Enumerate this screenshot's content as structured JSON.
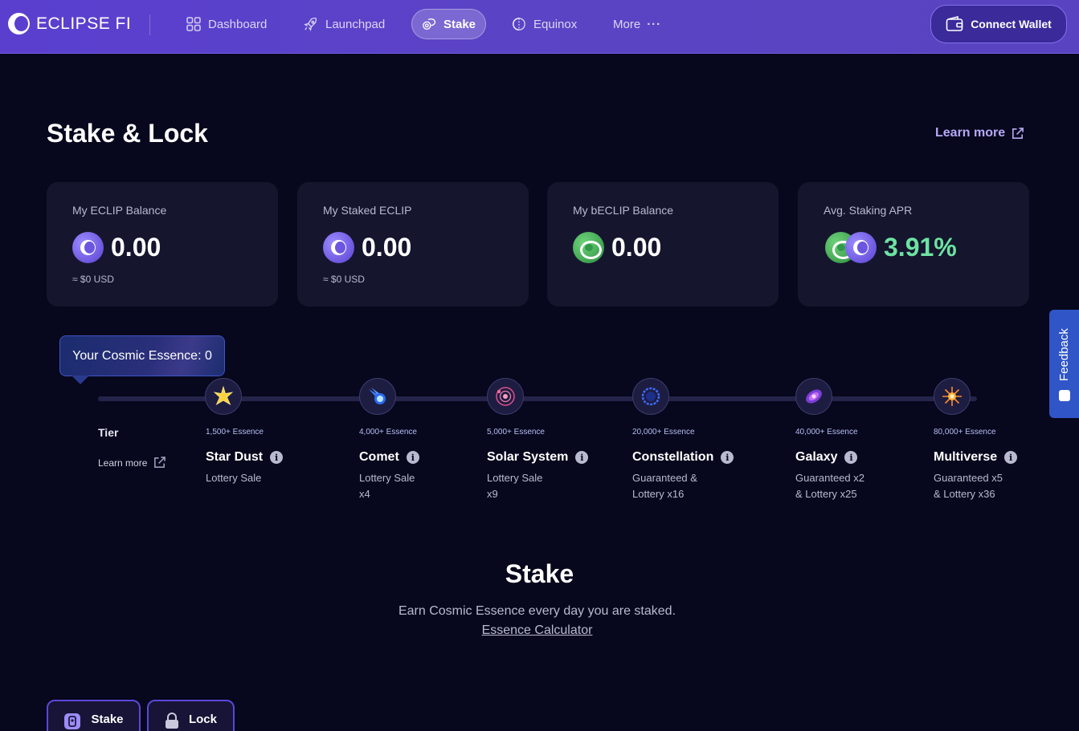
{
  "nav": {
    "brand": "ECLIPSE FI",
    "items": [
      {
        "label": "Dashboard",
        "icon": "grid-icon"
      },
      {
        "label": "Launchpad",
        "icon": "rocket-icon"
      },
      {
        "label": "Stake",
        "icon": "coins-icon",
        "active": true
      },
      {
        "label": "Equinox",
        "icon": "equinox-icon"
      },
      {
        "label": "More",
        "icon": "dots-icon"
      }
    ],
    "connect_label": "Connect Wallet"
  },
  "page": {
    "title": "Stake & Lock",
    "learn_more": "Learn more"
  },
  "cards": [
    {
      "label": "My ECLIP Balance",
      "value": "0.00",
      "sub": "≈ $0 USD",
      "coin": "eclip-coin-icon"
    },
    {
      "label": "My Staked ECLIP",
      "value": "0.00",
      "sub": "≈ $0 USD",
      "coin": "eclip-coin-icon"
    },
    {
      "label": "My bECLIP Balance",
      "value": "0.00",
      "coin": "beclip-coin-icon"
    },
    {
      "label": "Avg. Staking APR",
      "value": "3.91%",
      "coin": "beclip-eclip-coins-icon"
    }
  ],
  "tiers": {
    "essence_label": "Your Cosmic Essence: 0",
    "heading": "Tier",
    "learn_more": "Learn more",
    "levels": [
      {
        "essence": "1,500+ Essence",
        "name": "Star Dust",
        "desc": "Lottery Sale",
        "icon": "star-icon"
      },
      {
        "essence": "4,000+ Essence",
        "name": "Comet",
        "desc": "Lottery Sale x4",
        "icon": "comet-icon"
      },
      {
        "essence": "5,000+ Essence",
        "name": "Solar System",
        "desc": "Lottery Sale x9",
        "icon": "solar-system-icon"
      },
      {
        "essence": "20,000+ Essence",
        "name": "Constellation",
        "desc": "Guaranteed & Lottery x16",
        "icon": "constellation-icon"
      },
      {
        "essence": "40,000+ Essence",
        "name": "Galaxy",
        "desc": "Guaranteed x2 & Lottery x25",
        "icon": "galaxy-icon"
      },
      {
        "essence": "80,000+ Essence",
        "name": "Multiverse",
        "desc": "Guaranteed x5 & Lottery x36",
        "icon": "multiverse-icon"
      }
    ]
  },
  "stake": {
    "title": "Stake",
    "subtitle": "Earn Cosmic Essence every day you are staked.",
    "calculator": "Essence Calculator",
    "tabs": [
      {
        "label": "Stake",
        "icon": "stake-icon"
      },
      {
        "label": "Lock",
        "icon": "lock-icon"
      }
    ]
  },
  "feedback": {
    "label": "Feedback"
  }
}
